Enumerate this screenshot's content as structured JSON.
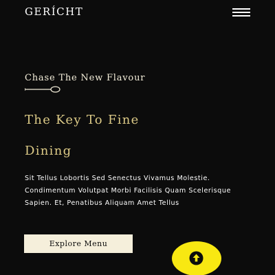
{
  "header": {
    "brand": "GERÍCHT",
    "menu_icon": "hamburger-menu-icon"
  },
  "hero": {
    "subtitle": "Chase The New Flavour",
    "divider_icon": "spoon-icon",
    "heading_line1": "The Key To Fine",
    "heading_line2": "Dining",
    "description": "Sit Tellus Lobortis Sed Senectus Vivamus Molestie. Condimentum Volutpat Morbi Facilisis Quam Scelerisque Sapien. Et, Penatibus Aliquam Amet Tellus",
    "cta_label": "Explore Menu"
  },
  "scroll_top": {
    "icon": "arrow-up-icon"
  },
  "colors": {
    "background": "#0c0c0c",
    "golden": "#dcca87",
    "crimson": "#f5efdb",
    "white": "#ffffff",
    "scroll_button": "#f8e812"
  }
}
